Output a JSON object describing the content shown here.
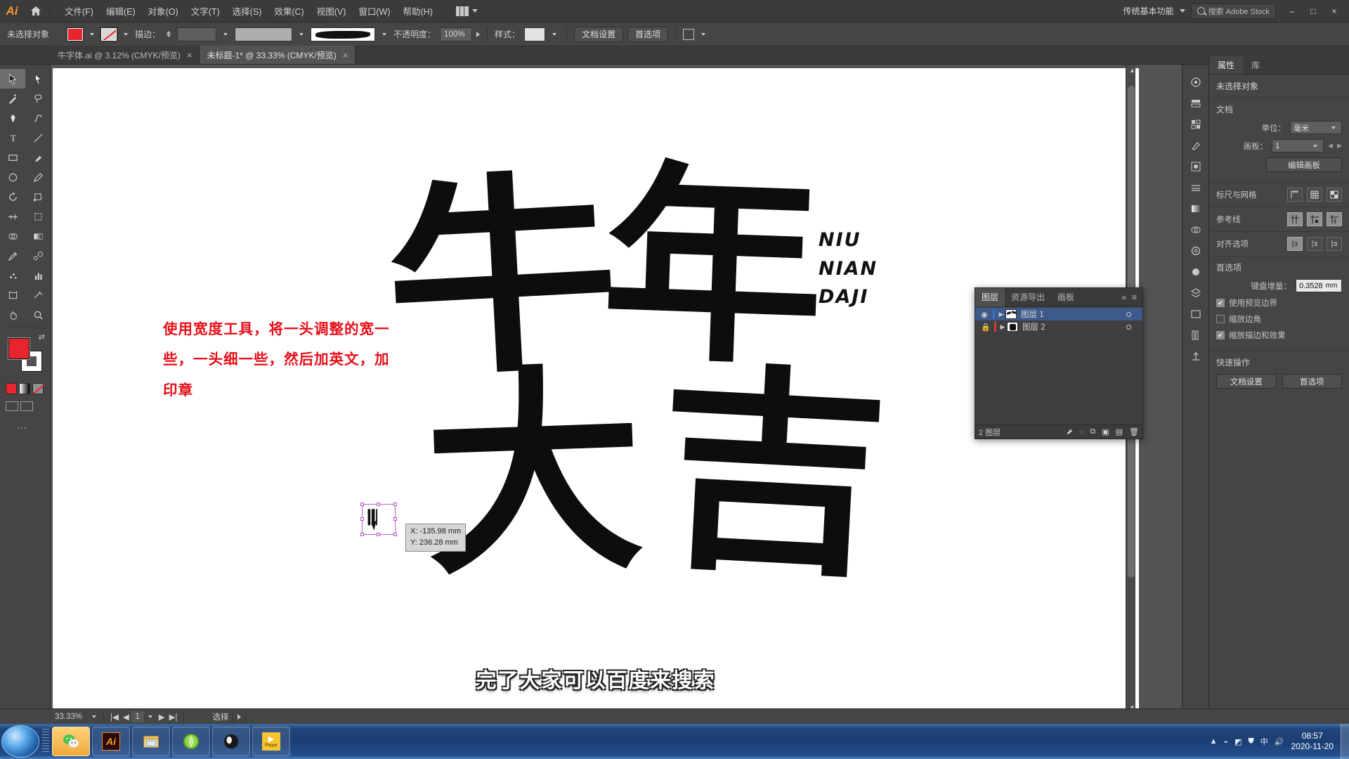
{
  "app": {
    "name": "Adobe Illustrator",
    "logo_text": "Ai",
    "workspace_name": "传统基本功能",
    "stock_label": "搜索 Adobe Stock"
  },
  "menubar": {
    "items": [
      {
        "label": "文件(F)"
      },
      {
        "label": "编辑(E)"
      },
      {
        "label": "对象(O)"
      },
      {
        "label": "文字(T)"
      },
      {
        "label": "选择(S)"
      },
      {
        "label": "效果(C)"
      },
      {
        "label": "视图(V)"
      },
      {
        "label": "窗口(W)"
      },
      {
        "label": "帮助(H)"
      }
    ],
    "window_buttons": [
      "–",
      "□",
      "×"
    ]
  },
  "controlbar": {
    "selection_label": "未选择对象",
    "fill_color": "#e8242c",
    "stroke_color": "none",
    "stroke_label": "描边：",
    "stroke_weight": "",
    "opacity_label": "不透明度：",
    "opacity_value": "100%",
    "style_label": "样式：",
    "doc_setup_label": "文档设置",
    "preferences_label": "首选项"
  },
  "tabs": [
    {
      "label": "牛字体.ai @ 3.12% (CMYK/预览)",
      "active": false,
      "close": "×"
    },
    {
      "label": "未标题-1* @ 33.33% (CMYK/预览)",
      "active": true,
      "close": "×"
    }
  ],
  "toolbar": {
    "tools": [
      {
        "name": "selection-tool",
        "glyph": "selection"
      },
      {
        "name": "direct-selection-tool",
        "glyph": "direct"
      },
      {
        "name": "magic-wand-tool",
        "glyph": "wand"
      },
      {
        "name": "lasso-tool",
        "glyph": "lasso"
      },
      {
        "name": "pen-tool",
        "glyph": "pen"
      },
      {
        "name": "curvature-tool",
        "glyph": "curvature"
      },
      {
        "name": "type-tool",
        "glyph": "T"
      },
      {
        "name": "line-segment-tool",
        "glyph": "line"
      },
      {
        "name": "rectangle-tool",
        "glyph": "rect"
      },
      {
        "name": "paintbrush-tool",
        "glyph": "brush"
      },
      {
        "name": "shaper-tool",
        "glyph": "shaper"
      },
      {
        "name": "pencil-tool",
        "glyph": "pencil"
      },
      {
        "name": "rotate-tool",
        "glyph": "rotate"
      },
      {
        "name": "scale-tool",
        "glyph": "scale"
      },
      {
        "name": "width-tool",
        "glyph": "width"
      },
      {
        "name": "free-transform-tool",
        "glyph": "freetransform"
      },
      {
        "name": "shape-builder-tool",
        "glyph": "shapebuilder"
      },
      {
        "name": "gradient-tool",
        "glyph": "gradient"
      },
      {
        "name": "eyedropper-tool",
        "glyph": "eyedropper"
      },
      {
        "name": "blend-tool",
        "glyph": "blend"
      },
      {
        "name": "symbol-sprayer-tool",
        "glyph": "symbol"
      },
      {
        "name": "column-graph-tool",
        "glyph": "graph"
      },
      {
        "name": "artboard-tool",
        "glyph": "artboard"
      },
      {
        "name": "slice-tool",
        "glyph": "slice"
      },
      {
        "name": "hand-tool",
        "glyph": "hand"
      },
      {
        "name": "zoom-tool",
        "glyph": "zoom"
      }
    ],
    "more_tools": "…"
  },
  "canvas": {
    "artwork_glyphs": [
      "牛",
      "年",
      "大",
      "吉"
    ],
    "english_lines": [
      "NIU",
      "NIAN",
      "DAJI"
    ],
    "annotation": "使用宽度工具，将一头调整的宽一些，一头细一些，然后加英文，加印章",
    "annotation_color": "#e60f19",
    "tooltip": {
      "x": "X: -135.98 mm",
      "y": "Y: 236.28 mm"
    },
    "subtitle": "完了大家可以百度来搜索"
  },
  "layers_panel": {
    "tabs": [
      {
        "label": "图层",
        "active": true
      },
      {
        "label": "资源导出",
        "active": false
      },
      {
        "label": "画板",
        "active": false
      }
    ],
    "collapse_icon": "»",
    "menu_icon": "≡",
    "rows": [
      {
        "name": "图层 1",
        "selected": true,
        "visible": true,
        "locked": false,
        "color": "#3b6fd4"
      },
      {
        "name": "图层 2",
        "selected": false,
        "visible": false,
        "locked": true,
        "color": "#d83a3a"
      }
    ],
    "footer_count": "2 图层",
    "footer_icons": [
      "locate-object",
      "make-clipping-mask",
      "create-new-sublayer",
      "create-new-layer",
      "delete-layer"
    ]
  },
  "properties": {
    "tabs": [
      {
        "label": "属性",
        "active": true
      },
      {
        "label": "库",
        "active": false
      }
    ],
    "no_selection": "未选择对象",
    "document": {
      "heading": "文档",
      "unit_label": "单位：",
      "unit_value": "毫米",
      "artboard_label": "画板：",
      "artboard_value": "1",
      "edit_artboard_button": "编辑画板"
    },
    "rulers_grid": {
      "heading": "标尺与网格",
      "icons": [
        "show-rulers",
        "show-grid",
        "show-transparency-grid"
      ]
    },
    "guides": {
      "heading": "参考线",
      "icons": [
        "show-guides",
        "lock-guides",
        "smart-guides"
      ]
    },
    "align": {
      "heading": "对齐选项",
      "icons": [
        "align-to-selection",
        "align-to-key-object",
        "align-to-artboard"
      ]
    },
    "preferences": {
      "heading": "首选项",
      "keyboard_increment_label": "键盘增量：",
      "keyboard_increment_value": "0.3528",
      "keyboard_increment_unit": "mm",
      "checkboxes": [
        {
          "label": "使用预览边界",
          "checked": true
        },
        {
          "label": "缩放边角",
          "checked": false
        },
        {
          "label": "缩放描边和效果",
          "checked": true
        }
      ]
    },
    "quick_actions": {
      "heading": "快速操作",
      "buttons": [
        "文档设置",
        "首选项"
      ]
    }
  },
  "dock_icons": [
    "color-panel-icon",
    "color-guide-icon",
    "swatches-icon",
    "brushes-icon",
    "symbols-icon",
    "stroke-icon",
    "gradient-icon",
    "transparency-icon",
    "appearance-icon",
    "graphic-styles-icon",
    "layers-icon",
    "artboards-icon",
    "libraries-icon",
    "asset-export-icon"
  ],
  "statusbar": {
    "zoom_value": "33.33%",
    "page_value": "1",
    "tool_name": "选择",
    "nav_first": "|◀",
    "nav_prev": "◀",
    "nav_next": "▶",
    "nav_last": "▶|"
  },
  "taskbar": {
    "items": [
      {
        "name": "wechat",
        "label": "",
        "active": true
      },
      {
        "name": "illustrator",
        "label": "Ai",
        "active": false
      },
      {
        "name": "file-explorer",
        "label": "",
        "active": false
      },
      {
        "name": "browser",
        "label": "",
        "active": false
      },
      {
        "name": "obs",
        "label": "",
        "active": false
      },
      {
        "name": "player",
        "label": "Player",
        "active": false
      }
    ],
    "clock_time": "08:57",
    "clock_date": "2020-11-20"
  }
}
